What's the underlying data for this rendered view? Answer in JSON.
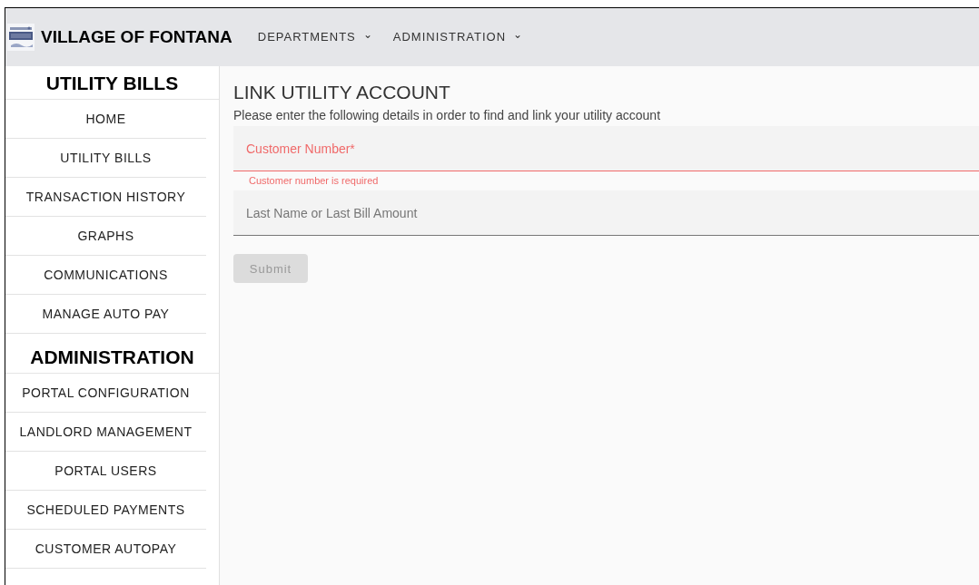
{
  "header": {
    "title": "VILLAGE OF FONTANA",
    "menus": [
      {
        "label": "DEPARTMENTS",
        "caret": "⌄"
      },
      {
        "label": "ADMINISTRATION",
        "caret": "⌄"
      }
    ]
  },
  "sidebar": {
    "sections": [
      {
        "heading": "UTILITY BILLS",
        "items": [
          "HOME",
          "UTILITY BILLS",
          "TRANSACTION HISTORY",
          "GRAPHS",
          "COMMUNICATIONS",
          "MANAGE AUTO PAY"
        ]
      },
      {
        "heading": "ADMINISTRATION",
        "items": [
          "PORTAL CONFIGURATION",
          "LANDLORD MANAGEMENT",
          "PORTAL USERS",
          "SCHEDULED PAYMENTS",
          "CUSTOMER AUTOPAY"
        ]
      }
    ]
  },
  "main": {
    "title": "LINK UTILITY ACCOUNT",
    "intro": "Please enter the following details in order to find and link your utility account",
    "fields": [
      {
        "placeholder": "Customer Number*",
        "error": true,
        "error_text": "Customer number is required"
      },
      {
        "placeholder": "Last Name or Last Bill Amount",
        "error": false
      }
    ],
    "submit": {
      "label": "Submit",
      "disabled": true
    }
  }
}
